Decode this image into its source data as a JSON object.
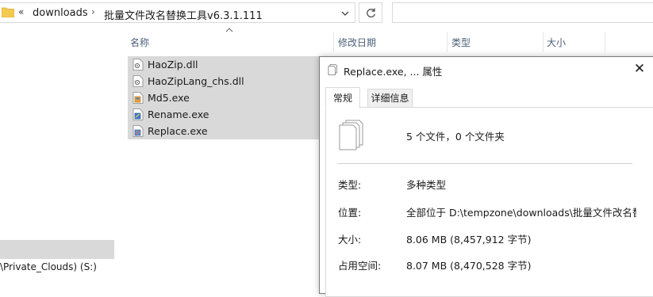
{
  "address_bar": {
    "separator": "«",
    "crumbs": [
      "downloads",
      "批量文件改名替换工具v6.3.1.111"
    ],
    "chevron": "›"
  },
  "columns": {
    "name": "名称",
    "modified": "修改日期",
    "type": "类型",
    "size": "大小"
  },
  "files": [
    {
      "name": "HaoZip.dll",
      "icon": "dll-file-icon"
    },
    {
      "name": "HaoZipLang_chs.dll",
      "icon": "dll-file-icon"
    },
    {
      "name": "Md5.exe",
      "icon": "exe-file-icon"
    },
    {
      "name": "Rename.exe",
      "icon": "exe-file-icon"
    },
    {
      "name": "Replace.exe",
      "icon": "exe-file-icon"
    }
  ],
  "nav": {
    "drive_label": "\\Private_Clouds) (S:)"
  },
  "dialog": {
    "title": "Replace.exe, ... 属性",
    "close": "✕",
    "tabs": [
      "常规",
      "详细信息"
    ],
    "active_tab": "常规",
    "summary": "5 个文件，0 个文件夹",
    "properties": [
      {
        "label": "类型:",
        "value": "多种类型"
      },
      {
        "label": "位置:",
        "value": "全部位于 D:\\tempzone\\downloads\\批量文件改名替"
      },
      {
        "label": "大小:",
        "value": "8.06 MB (8,457,912 字节)"
      },
      {
        "label": "占用空间:",
        "value": "8.07 MB (8,470,528 字节)"
      }
    ]
  },
  "colors": {
    "selection": "#d9d9d9",
    "header_text": "#4c607a",
    "folder": "#f4c94f"
  }
}
